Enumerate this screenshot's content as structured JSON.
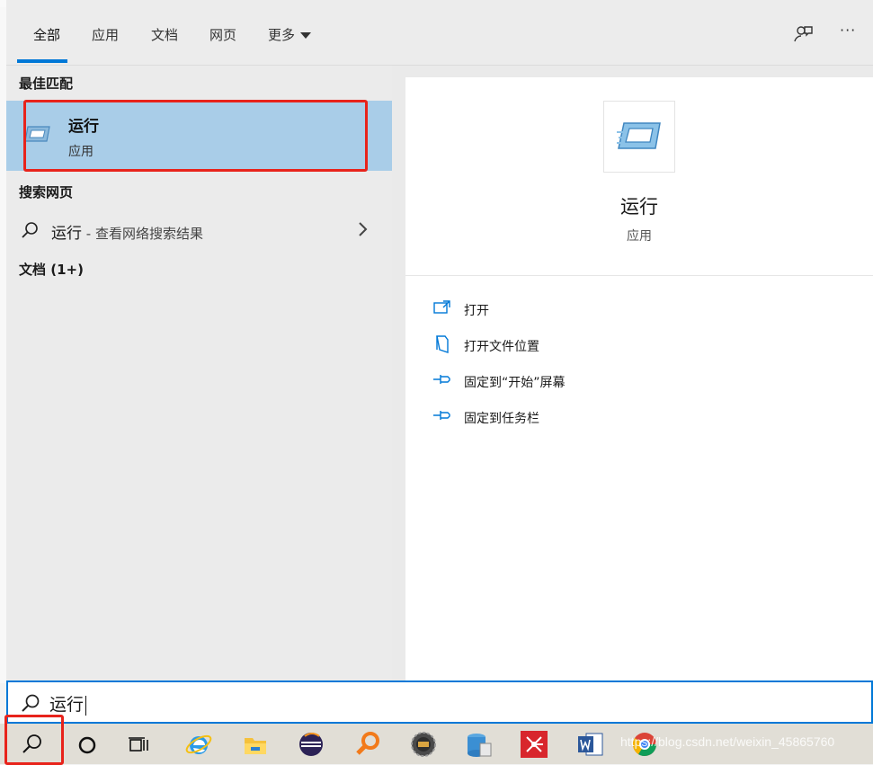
{
  "tabs": [
    {
      "label": "全部"
    },
    {
      "label": "应用"
    },
    {
      "label": "文档"
    },
    {
      "label": "网页"
    },
    {
      "label": "更多"
    }
  ],
  "toolbar": {
    "feedback_icon": "feedback-icon",
    "more_icon": "more-icon",
    "more_label": "···"
  },
  "sections": {
    "best_match": "最佳匹配",
    "web_search": "搜索网页",
    "documents": "文档 (1+)"
  },
  "best_match": {
    "title": "运行",
    "subtitle": "应用",
    "icon": "run-app-icon"
  },
  "web_result": {
    "query": "运行",
    "suffix": " - 查看网络搜索结果"
  },
  "preview": {
    "title": "运行",
    "subtitle": "应用"
  },
  "actions": [
    {
      "label": "打开",
      "icon": "open-icon"
    },
    {
      "label": "打开文件位置",
      "icon": "file-location-icon"
    },
    {
      "label": "固定到“开始”屏幕",
      "icon": "pin-icon"
    },
    {
      "label": "固定到任务栏",
      "icon": "pin-icon"
    }
  ],
  "search": {
    "value": "运行"
  },
  "taskbar_icons": [
    "search-icon",
    "cortana-icon",
    "task-view-icon",
    "ie-icon",
    "file-explorer-icon",
    "eclipse-icon",
    "magnifier-app-icon",
    "dev-ide-icon",
    "database-icon",
    "xmind-icon",
    "word-icon",
    "chrome-icon"
  ],
  "watermark": "https://blog.csdn.net/weixin_45865760",
  "colors": {
    "accent": "#0078d7",
    "selection": "#a9cde8",
    "highlight_box": "#e8231b"
  }
}
